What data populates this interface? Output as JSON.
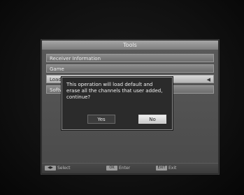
{
  "menu": {
    "title": "Tools",
    "items": [
      {
        "label": "Receiver Information"
      },
      {
        "label": "Game"
      },
      {
        "label": "Load Factory Default"
      },
      {
        "label": "Software Upgrade"
      }
    ],
    "item_arrow": "◀"
  },
  "dialog": {
    "line1": "This operation will load default and",
    "line2": "erase all the channels that user added,",
    "line3": "continue?",
    "yes_label": "Yes",
    "no_label": "No"
  },
  "footer": {
    "select_key": "◀▶",
    "select_label": "Select",
    "enter_key": "OK",
    "enter_label": "Enter",
    "exit_key": "EXIT",
    "exit_label": "Exit"
  }
}
